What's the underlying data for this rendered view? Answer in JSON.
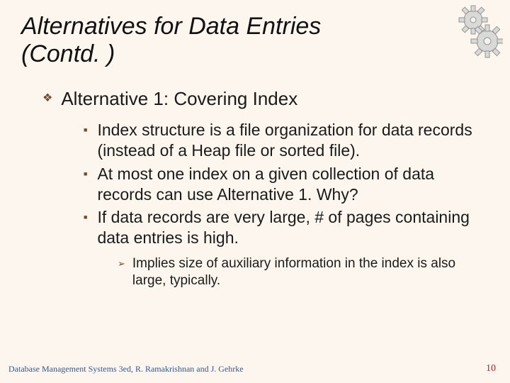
{
  "title_line1": "Alternatives for Data Entries",
  "title_line2": "(Contd. )",
  "level1": {
    "heading": "Alternative 1: Covering Index"
  },
  "level2": {
    "items": [
      "Index structure is a file organization for data records (instead of a Heap file or sorted file).",
      "At most one index on a given collection of data records can use Alternative 1. Why?",
      "If data records are very large,  # of pages containing data entries is high."
    ]
  },
  "level3": {
    "items": [
      "Implies size of auxiliary information in the index is also large, typically."
    ]
  },
  "footer": {
    "left": "Database Management Systems 3ed, R. Ramakrishnan and J. Gehrke",
    "page": "10"
  },
  "icons": {
    "diamond": "❖",
    "square": "■",
    "arrow": "➢"
  }
}
